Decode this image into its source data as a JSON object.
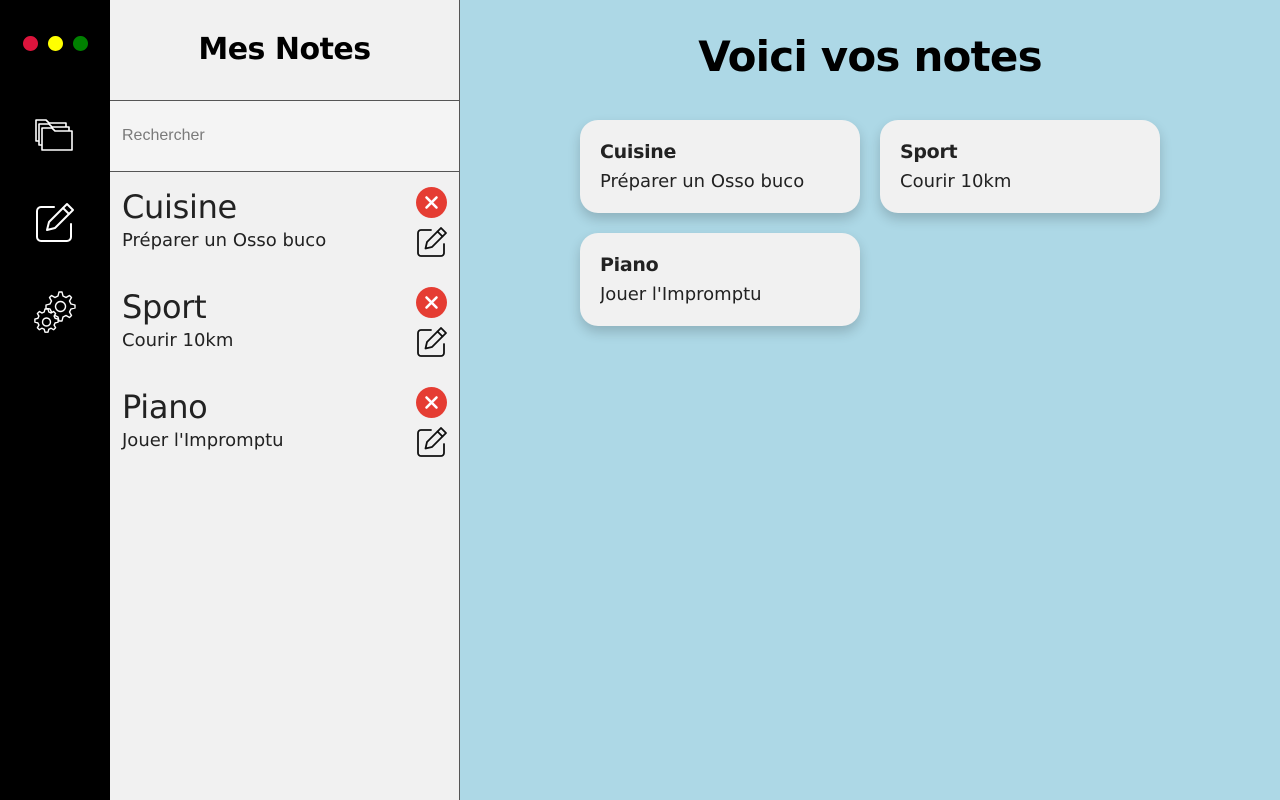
{
  "window": {
    "controls": [
      "#dc143c",
      "#ffff00",
      "#008000"
    ]
  },
  "rail": {
    "items": [
      {
        "icon": "folders-icon"
      },
      {
        "icon": "edit-note-icon"
      },
      {
        "icon": "settings-gear-icon"
      }
    ]
  },
  "sidebar": {
    "title": "Mes Notes",
    "search": {
      "placeholder": "Rechercher",
      "value": ""
    },
    "notes": [
      {
        "title": "Cuisine",
        "body": "Préparer un Osso buco"
      },
      {
        "title": "Sport",
        "body": "Courir 10km"
      },
      {
        "title": "Piano",
        "body": "Jouer l'Impromptu"
      }
    ]
  },
  "main": {
    "title": "Voici vos notes",
    "cards": [
      {
        "title": "Cuisine",
        "body": "Préparer un Osso buco"
      },
      {
        "title": "Sport",
        "body": "Courir 10km"
      },
      {
        "title": "Piano",
        "body": "Jouer l'Impromptu"
      }
    ]
  },
  "colors": {
    "rail_bg": "#000000",
    "sidebar_bg": "#f1f1f1",
    "main_bg": "#add8e6",
    "delete_red": "#e53d33"
  }
}
